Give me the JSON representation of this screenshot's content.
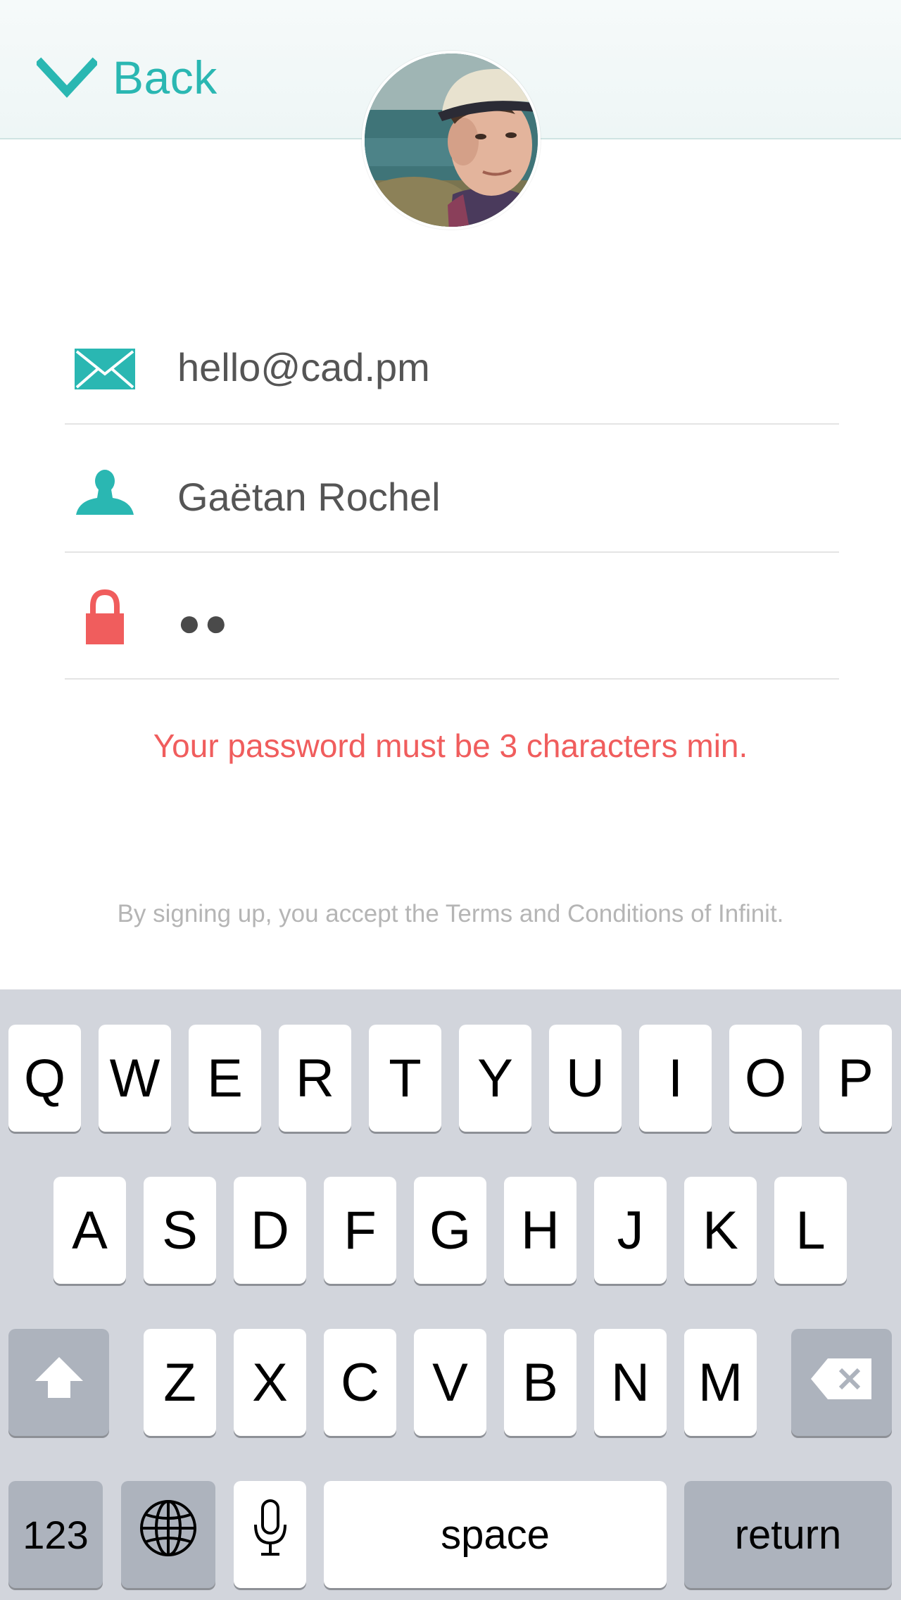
{
  "header": {
    "back_label": "Back"
  },
  "avatar": {
    "icon": "profile-photo"
  },
  "form": {
    "email": {
      "value": "hello@cad.pm",
      "icon": "envelope-icon"
    },
    "name": {
      "value": "Gaëtan Rochel",
      "icon": "user-icon"
    },
    "password": {
      "value": "●●",
      "icon": "lock-icon"
    }
  },
  "error_message": "Your password must be 3 characters min.",
  "terms_text": "By signing up, you accept the Terms and Conditions of Infinit.",
  "keyboard": {
    "row1": [
      "Q",
      "W",
      "E",
      "R",
      "T",
      "Y",
      "U",
      "I",
      "O",
      "P"
    ],
    "row2": [
      "A",
      "S",
      "D",
      "F",
      "G",
      "H",
      "J",
      "K",
      "L"
    ],
    "row3": [
      "Z",
      "X",
      "C",
      "V",
      "B",
      "N",
      "M"
    ],
    "numbers_label": "123",
    "space_label": "space",
    "return_label": "return"
  },
  "colors": {
    "accent": "#2ab7b2",
    "error": "#f05d5d",
    "keyboard_bg": "#d2d5dc"
  }
}
